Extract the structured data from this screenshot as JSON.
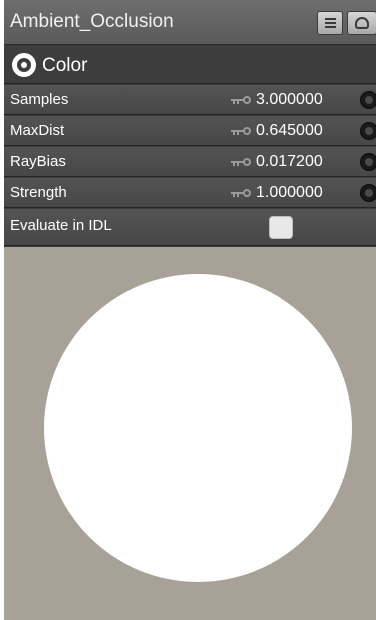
{
  "node": {
    "title": "Ambient_Occlusion",
    "output_label": "Color"
  },
  "params": [
    {
      "name": "Samples",
      "value": "3.000000"
    },
    {
      "name": "MaxDist",
      "value": "0.645000"
    },
    {
      "name": "RayBias",
      "value": "0.017200"
    },
    {
      "name": "Strength",
      "value": "1.000000"
    }
  ],
  "evaluate": {
    "label": "Evaluate in IDL",
    "checked": false
  },
  "icons": {
    "output": "output-socket-icon",
    "key": "keyframe-icon",
    "connector": "input-connector-icon",
    "list_button": "list-icon",
    "preview_button": "preview-icon"
  },
  "colors": {
    "preview_background": "#a8a197",
    "sphere": "#ffffff",
    "panel": "#3c3c3c"
  }
}
